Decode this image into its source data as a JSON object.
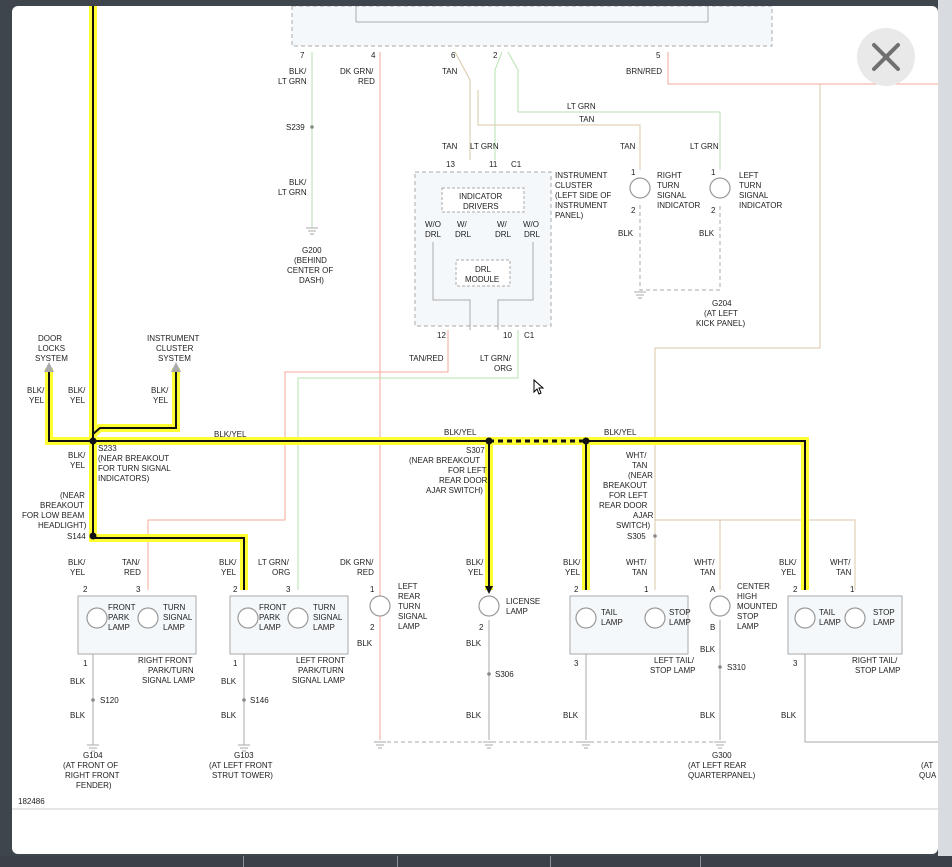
{
  "close_button": {
    "icon": "close-icon",
    "color": "#707070"
  },
  "colors": {
    "highlight": "#ffff33",
    "wire_black": "#111111",
    "wire_tan": "#d8c7a6",
    "wire_ltgrn": "#b6e3b0",
    "wire_red": "#f0a898",
    "ground": "#aaaaaa",
    "component_fill": "#f4f8fb"
  },
  "diagram_id": "182486",
  "top_pins": [
    "7",
    "4",
    "6",
    "2",
    "5"
  ],
  "labels": {
    "blk_ltgrn_1": [
      "BLK/",
      "LT GRN"
    ],
    "dkgrn_red_1": [
      "DK GRN/",
      "RED"
    ],
    "tan_1": "TAN",
    "brn_red": "BRN/RED",
    "ltgrn_upper": "LT GRN",
    "tan_upper": "TAN",
    "s239": "S239",
    "blk_ltgrn_2": [
      "BLK/",
      "LT GRN"
    ],
    "g200": [
      "G200",
      "(BEHIND",
      "CENTER OF",
      "DASH)"
    ],
    "ic_tan": "TAN",
    "ic_ltgrn": "LT GRN",
    "ic_pin13": "13",
    "ic_pin11": "11",
    "ic_c1_top": "C1",
    "ic_title": [
      "INSTRUMENT",
      "CLUSTER",
      "(LEFT SIDE OF",
      "INSTRUMENT",
      "PANEL)"
    ],
    "indicator_drivers": [
      "INDICATOR",
      "DRIVERS"
    ],
    "wo_drl_1": [
      "W/O",
      "DRL"
    ],
    "w_drl_1": [
      "W/",
      "DRL"
    ],
    "w_drl_2": [
      "W/",
      "DRL"
    ],
    "wo_drl_2": [
      "W/O",
      "DRL"
    ],
    "drl_module": [
      "DRL",
      "MODULE"
    ],
    "ic_pin12": "12",
    "ic_pin10": "10",
    "ic_c1_bottom": "C1",
    "tan_red": "TAN/RED",
    "ltgrn_org_1": [
      "LT GRN/",
      "ORG"
    ],
    "right_turn_tan": "TAN",
    "right_turn_ind": [
      "RIGHT",
      "TURN",
      "SIGNAL",
      "INDICATOR"
    ],
    "left_turn_ltgrn": "LT GRN",
    "left_turn_ind": [
      "LEFT",
      "TURN",
      "SIGNAL",
      "INDICATOR"
    ],
    "ind_pin1_a": "1",
    "ind_pin2_a": "2",
    "ind_pin1_b": "1",
    "ind_pin2_b": "2",
    "blk_ind_a": "BLK",
    "blk_ind_b": "BLK",
    "g204": [
      "G204",
      "(AT LEFT",
      "KICK PANEL)"
    ],
    "door_locks": [
      "DOOR",
      "LOCKS",
      "SYSTEM"
    ],
    "inst_cluster_sys": [
      "INSTRUMENT",
      "CLUSTER",
      "SYSTEM"
    ],
    "blk_yel_a": [
      "BLK/",
      "YEL"
    ],
    "blk_yel_b": [
      "BLK/",
      "YEL"
    ],
    "blk_yel_c": [
      "BLK/",
      "YEL"
    ],
    "blk_yel_main1": "BLK/YEL",
    "blk_yel_main2": "BLK/YEL",
    "blk_yel_main3": "BLK/YEL",
    "s233": [
      "S233",
      "(NEAR BREAKOUT",
      "FOR TURN SIGNAL",
      "INDICATORS)"
    ],
    "blk_yel_d": [
      "BLK/",
      "YEL"
    ],
    "s307": [
      "S307",
      "(NEAR BREAKOUT",
      "FOR LEFT",
      "REAR DOOR",
      "AJAR SWITCH)"
    ],
    "wht_tan_breakout": [
      "WHT/",
      "TAN",
      "(NEAR",
      "BREAKOUT",
      "FOR LEFT",
      "REAR DOOR",
      "AJAR",
      "SWITCH)"
    ],
    "s305": "S305",
    "near_breakout_lowbeam": [
      "(NEAR",
      "BREAKOUT",
      "FOR LOW BEAM",
      "HEADLIGHT)"
    ],
    "s144": "S144",
    "c1_blk_yel": [
      "BLK/",
      "YEL"
    ],
    "c1_tan_red": [
      "TAN/",
      "RED"
    ],
    "c2_blk_yel": [
      "BLK/",
      "YEL"
    ],
    "c2_ltgrn_org": [
      "LT GRN/",
      "ORG"
    ],
    "c3_dkgrn_red": [
      "DK GRN/",
      "RED"
    ],
    "c4_blk_yel": [
      "BLK/",
      "YEL"
    ],
    "c5_blk_yel": [
      "BLK/",
      "YEL"
    ],
    "c5_wht_tan": [
      "WHT/",
      "TAN"
    ],
    "c6_wht_tan": [
      "WHT/",
      "TAN"
    ],
    "c7_blk_yel": [
      "BLK/",
      "YEL"
    ],
    "c7_wht_tan": [
      "WHT/",
      "TAN"
    ],
    "front_park_1": [
      "FRONT",
      "PARK",
      "LAMP"
    ],
    "turn_sig_1": [
      "TURN",
      "SIGNAL",
      "LAMP"
    ],
    "rf_park_turn": [
      "RIGHT FRONT",
      "PARK/TURN",
      "SIGNAL LAMP"
    ],
    "front_park_2": [
      "FRONT",
      "PARK",
      "LAMP"
    ],
    "turn_sig_2": [
      "TURN",
      "SIGNAL",
      "LAMP"
    ],
    "lf_park_turn": [
      "LEFT FRONT",
      "PARK/TURN",
      "SIGNAL LAMP"
    ],
    "left_rear_turn": [
      "LEFT",
      "REAR",
      "TURN",
      "SIGNAL",
      "LAMP"
    ],
    "license_lamp": [
      "LICENSE",
      "LAMP"
    ],
    "tail_lamp_1": [
      "TAIL",
      "LAMP"
    ],
    "stop_lamp_1": [
      "STOP",
      "LAMP"
    ],
    "left_tail_stop": [
      "LEFT TAIL/",
      "STOP LAMP"
    ],
    "chmsl": [
      "CENTER",
      "HIGH",
      "MOUNTED",
      "STOP",
      "LAMP"
    ],
    "tail_lamp_2": [
      "TAIL",
      "LAMP"
    ],
    "stop_lamp_2": [
      "STOP",
      "LAMP"
    ],
    "right_tail_stop": [
      "RIGHT TAIL/",
      "STOP LAMP"
    ],
    "pins_row": [
      "2",
      "3",
      "2",
      "3",
      "1",
      "2",
      "1",
      "A",
      "2",
      "1"
    ],
    "pins_lower": [
      "1",
      "1",
      "2",
      "2",
      "3",
      "B",
      "3"
    ],
    "blk_lower": [
      "BLK",
      "BLK",
      "BLK",
      "BLK",
      "BLK",
      "BLK",
      "BLK",
      "BLK",
      "BLK"
    ],
    "s120": "S120",
    "s146": "S146",
    "s306": "S306",
    "s310": "S310",
    "g104": [
      "G104",
      "(AT FRONT OF",
      "RIGHT FRONT",
      "FENDER)"
    ],
    "g103": [
      "G103",
      "(AT LEFT FRONT",
      "STRUT TOWER)"
    ],
    "g300": [
      "G300",
      "(AT LEFT REAR",
      "QUARTERPANEL)"
    ],
    "g_cut": [
      "(AT",
      "QUA"
    ]
  }
}
